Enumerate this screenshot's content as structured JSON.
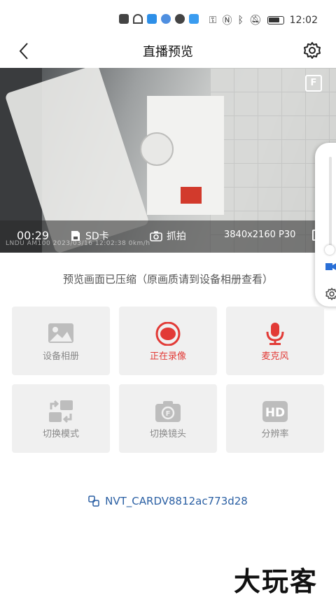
{
  "status_bar": {
    "time": "12:02"
  },
  "nav": {
    "title": "直播预览"
  },
  "video": {
    "duration": "00:29",
    "storage_label": "SD卡",
    "snapshot_label": "抓拍",
    "resolution": "3840x2160 P30",
    "watermark": "LNDU  AM100  2023/03/16 12:02:38  0km/h",
    "flag_letter": "F"
  },
  "notice": "预览画面已压缩（原画质请到设备相册查看）",
  "tiles": [
    {
      "label": "设备相册",
      "icon": "gallery-icon",
      "active": false
    },
    {
      "label": "正在录像",
      "icon": "record-icon",
      "active": true
    },
    {
      "label": "麦克风",
      "icon": "microphone-icon",
      "active": true
    },
    {
      "label": "切换模式",
      "icon": "switch-mode-icon",
      "active": false
    },
    {
      "label": "切换镜头",
      "icon": "switch-camera-icon",
      "active": false
    },
    {
      "label": "分辨率",
      "icon": "hd-icon",
      "active": false
    }
  ],
  "device": {
    "name": "NVT_CARDV8812ac773d28"
  },
  "brand": "大玩客",
  "colors": {
    "accent_red": "#e23a36",
    "link_blue": "#2a5fa3",
    "tile_bg": "#f0f0f0",
    "inactive_icon": "#bdbdbd"
  }
}
